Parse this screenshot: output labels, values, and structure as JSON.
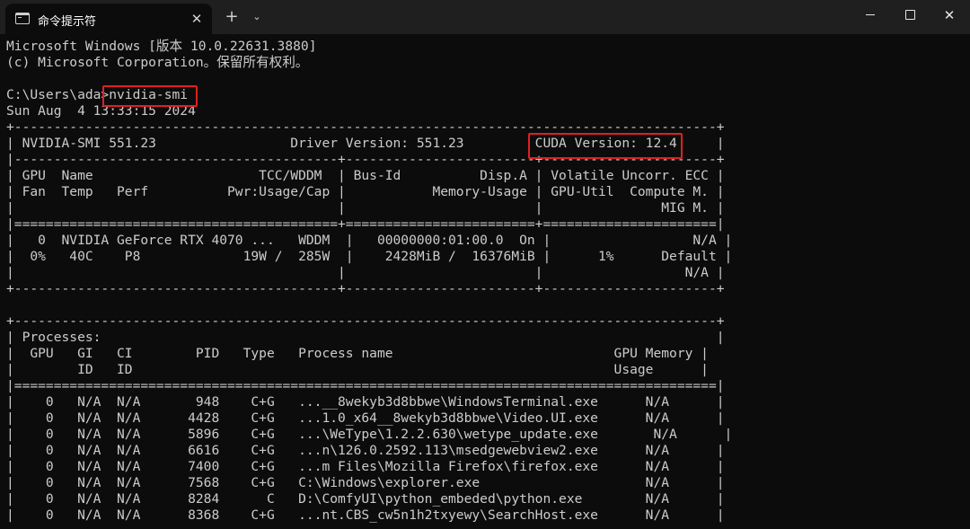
{
  "window": {
    "tab_title": "命令提示符",
    "tab_close": "✕",
    "new_tab": "+",
    "dropdown": "⌄",
    "close": "✕"
  },
  "terminal": {
    "lines": [
      "Microsoft Windows [版本 10.0.22631.3880]",
      "(c) Microsoft Corporation。保留所有权利。",
      "",
      "C:\\Users\\ada>nvidia-smi",
      "Sun Aug  4 13:33:15 2024",
      "+-----------------------------------------------------------------------------------------+",
      "| NVIDIA-SMI 551.23                 Driver Version: 551.23         CUDA Version: 12.4     |",
      "|-----------------------------------------+------------------------+----------------------+",
      "| GPU  Name                     TCC/WDDM  | Bus-Id          Disp.A | Volatile Uncorr. ECC |",
      "| Fan  Temp   Perf          Pwr:Usage/Cap |           Memory-Usage | GPU-Util  Compute M. |",
      "|                                         |                        |               MIG M. |",
      "|=========================================+========================+======================|",
      "|   0  NVIDIA GeForce RTX 4070 ...   WDDM  |   00000000:01:00.0  On |                  N/A |",
      "|  0%   40C    P8             19W /  285W  |    2428MiB /  16376MiB |      1%      Default |",
      "|                                         |                        |                  N/A |",
      "+-----------------------------------------+------------------------+----------------------+",
      "",
      "+-----------------------------------------------------------------------------------------+",
      "| Processes:                                                                              |",
      "|  GPU   GI   CI        PID   Type   Process name                            GPU Memory |",
      "|        ID   ID                                                             Usage      |",
      "|=========================================================================================|",
      "|    0   N/A  N/A       948    C+G   ...__8wekyb3d8bbwe\\WindowsTerminal.exe      N/A      |",
      "|    0   N/A  N/A      4428    C+G   ...1.0_x64__8wekyb3d8bbwe\\Video.UI.exe      N/A      |",
      "|    0   N/A  N/A      5896    C+G   ...\\WeType\\1.2.2.630\\wetype_update.exe       N/A      |",
      "|    0   N/A  N/A      6616    C+G   ...n\\126.0.2592.113\\msedgewebview2.exe      N/A      |",
      "|    0   N/A  N/A      7400    C+G   ...m Files\\Mozilla Firefox\\firefox.exe      N/A      |",
      "|    0   N/A  N/A      7568    C+G   C:\\Windows\\explorer.exe                     N/A      |",
      "|    0   N/A  N/A      8284      C   D:\\ComfyUI\\python_embeded\\python.exe        N/A      |",
      "|    0   N/A  N/A      8368    C+G   ...nt.CBS_cw5n1h2txyewy\\SearchHost.exe      N/A      |"
    ]
  }
}
